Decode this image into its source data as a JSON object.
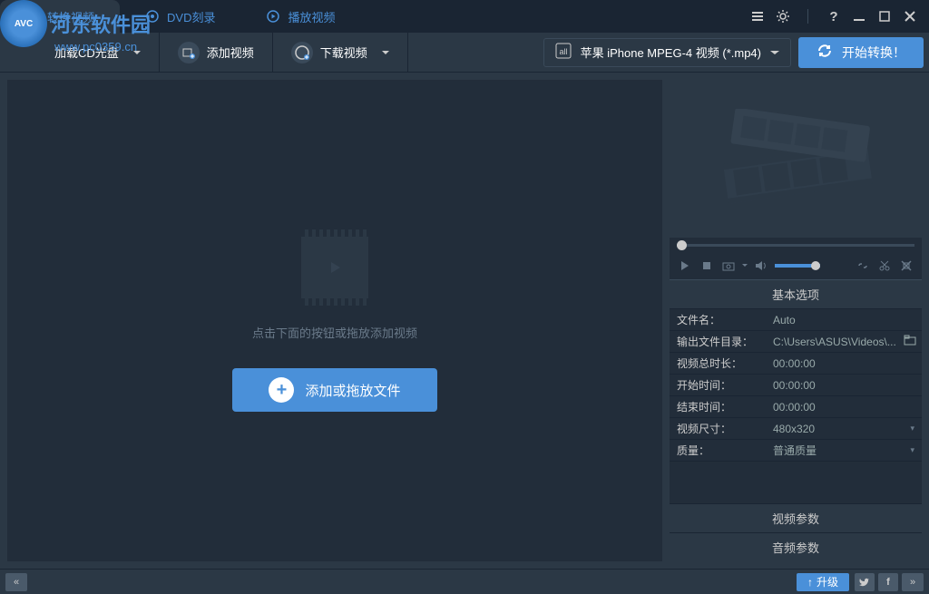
{
  "watermark": {
    "brand": "河东软件园",
    "url": "www.pc0359.cn",
    "logo_badge": "AVC"
  },
  "tabs": [
    {
      "label": "转换视频",
      "icon": "refresh"
    },
    {
      "label": "DVD刻录",
      "icon": "disc"
    },
    {
      "label": "播放视频",
      "icon": "play"
    }
  ],
  "toolbar": {
    "load_cd": "加载CD光盘",
    "add_video": "添加视频",
    "download_video": "下载视频",
    "format_selected": "苹果 iPhone MPEG-4 视频 (*.mp4)",
    "start_convert": "开始转换！"
  },
  "content": {
    "placeholder_text": "点击下面的按钮或拖放添加视频",
    "add_button": "添加或拖放文件"
  },
  "right": {
    "basic_options": "基本选项",
    "props": [
      {
        "label": "文件名：",
        "value": "Auto"
      },
      {
        "label": "输出文件目录：",
        "value": "C:\\Users\\ASUS\\Videos\\...",
        "browse": true
      },
      {
        "label": "视频总时长：",
        "value": "00:00:00"
      },
      {
        "label": "开始时间：",
        "value": "00:00:00"
      },
      {
        "label": "结束时间：",
        "value": "00:00:00"
      },
      {
        "label": "视频尺寸：",
        "value": "480x320",
        "dropdown": true
      },
      {
        "label": "质量：",
        "value": "普通质量",
        "dropdown": true
      }
    ],
    "video_params": "视频参数",
    "audio_params": "音频参数"
  },
  "bottom": {
    "upgrade": "升级"
  }
}
